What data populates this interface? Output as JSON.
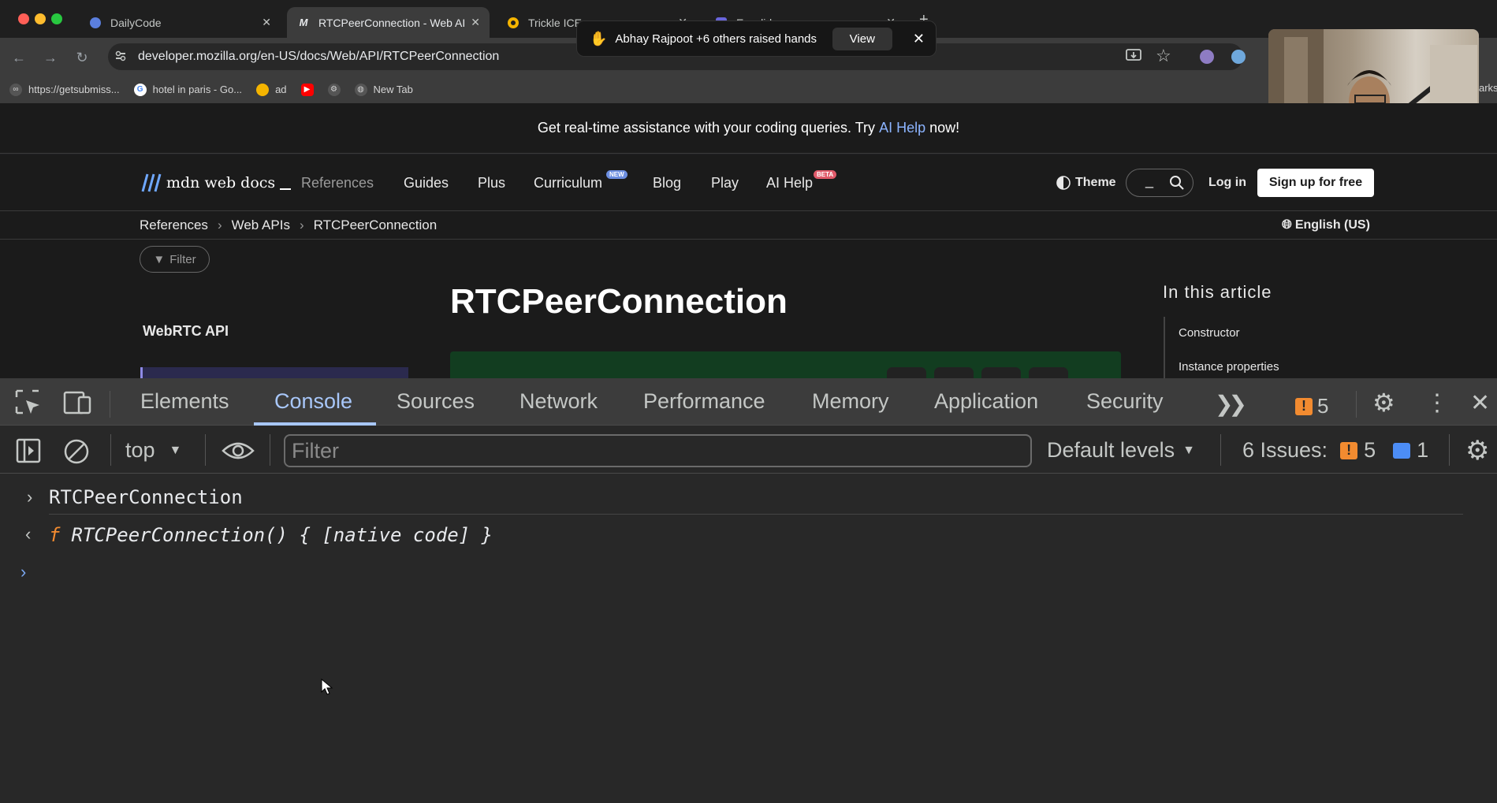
{
  "browser": {
    "tabs": [
      {
        "title": "DailyCode",
        "active": false
      },
      {
        "title": "RTCPeerConnection - Web AI",
        "active": true
      },
      {
        "title": "Trickle ICE",
        "active": false
      },
      {
        "title": "Excalidraw",
        "active": false
      }
    ],
    "url": "developer.mozilla.org/en-US/docs/Web/API/RTCPeerConnection",
    "bookmarks": [
      "https://getsubmiss...",
      "hotel in paris - Go...",
      "ad",
      "New Tab"
    ],
    "bookmarks_overflow_partial": "arks"
  },
  "notification": {
    "text": "Abhay Rajpoot +6 others raised hands",
    "view_label": "View"
  },
  "mdn": {
    "banner_prefix": "Get real-time assistance with your coding queries. Try ",
    "banner_link": "AI Help",
    "banner_suffix": " now!",
    "logo_text": "mdn web docs",
    "nav": [
      "References",
      "Guides",
      "Plus",
      "Curriculum",
      "Blog",
      "Play",
      "AI Help"
    ],
    "nav_badges": {
      "curriculum": "NEW",
      "ai_help": "BETA"
    },
    "theme_label": "Theme",
    "search_placeholder": "_",
    "login_label": "Log in",
    "signup_label": "Sign up for free",
    "breadcrumbs": [
      "References",
      "Web APIs",
      "RTCPeerConnection"
    ],
    "language": "English (US)",
    "filter_label": "Filter",
    "sidebar_heading": "WebRTC API",
    "page_title": "RTCPeerConnection",
    "toc_heading": "In this article",
    "toc": [
      "Constructor",
      "Instance properties"
    ]
  },
  "devtools": {
    "tabs": [
      "Elements",
      "Console",
      "Sources",
      "Network",
      "Performance",
      "Memory",
      "Application",
      "Security"
    ],
    "active_tab": "Console",
    "issue_count_badge": "5",
    "context": "top",
    "filter_placeholder": "Filter",
    "levels": "Default levels",
    "issues_label": "6 Issues:",
    "issues_warning_count": "5",
    "issues_info_count": "1",
    "console": {
      "input": "RTCPeerConnection",
      "output_prefix": "f",
      "output": "RTCPeerConnection() { [native code] }"
    }
  },
  "colors": {
    "accent": "#a8c7fa",
    "warning": "#f28b30",
    "info": "#4c8df6",
    "mdn_link": "#8cb4ff"
  }
}
